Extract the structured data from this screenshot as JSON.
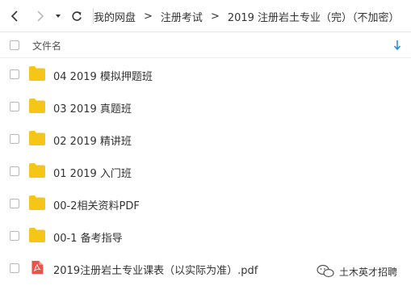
{
  "toolbar": {
    "back_icon": "chevron-left-icon",
    "forward_icon": "chevron-right-icon",
    "history_icon": "caret-down-icon",
    "refresh_icon": "refresh-icon"
  },
  "breadcrumb": [
    "我的网盘",
    "注册考试",
    "2019 注册岩土专业（完）（不加密）"
  ],
  "breadcrumb_separator": ">",
  "list_header": {
    "name_label": "文件名",
    "sort_icon": "sort-down-arrow-icon"
  },
  "files": [
    {
      "name": "04 2019 模拟押题班",
      "type": "folder"
    },
    {
      "name": "03 2019 真题班",
      "type": "folder"
    },
    {
      "name": "02 2019 精讲班",
      "type": "folder"
    },
    {
      "name": "01 2019 入门班",
      "type": "folder"
    },
    {
      "name": "00-2相关资料PDF",
      "type": "folder"
    },
    {
      "name": "00-1 备考指导",
      "type": "folder"
    },
    {
      "name": "2019注册岩土专业课表（以实际为准）.pdf",
      "type": "pdf"
    }
  ],
  "watermark": {
    "text": "土木英才招聘",
    "icon": "wechat-icon"
  },
  "colors": {
    "folder": "#f5c518",
    "pdf": "#e8534a",
    "accent": "#2b8fe0"
  }
}
